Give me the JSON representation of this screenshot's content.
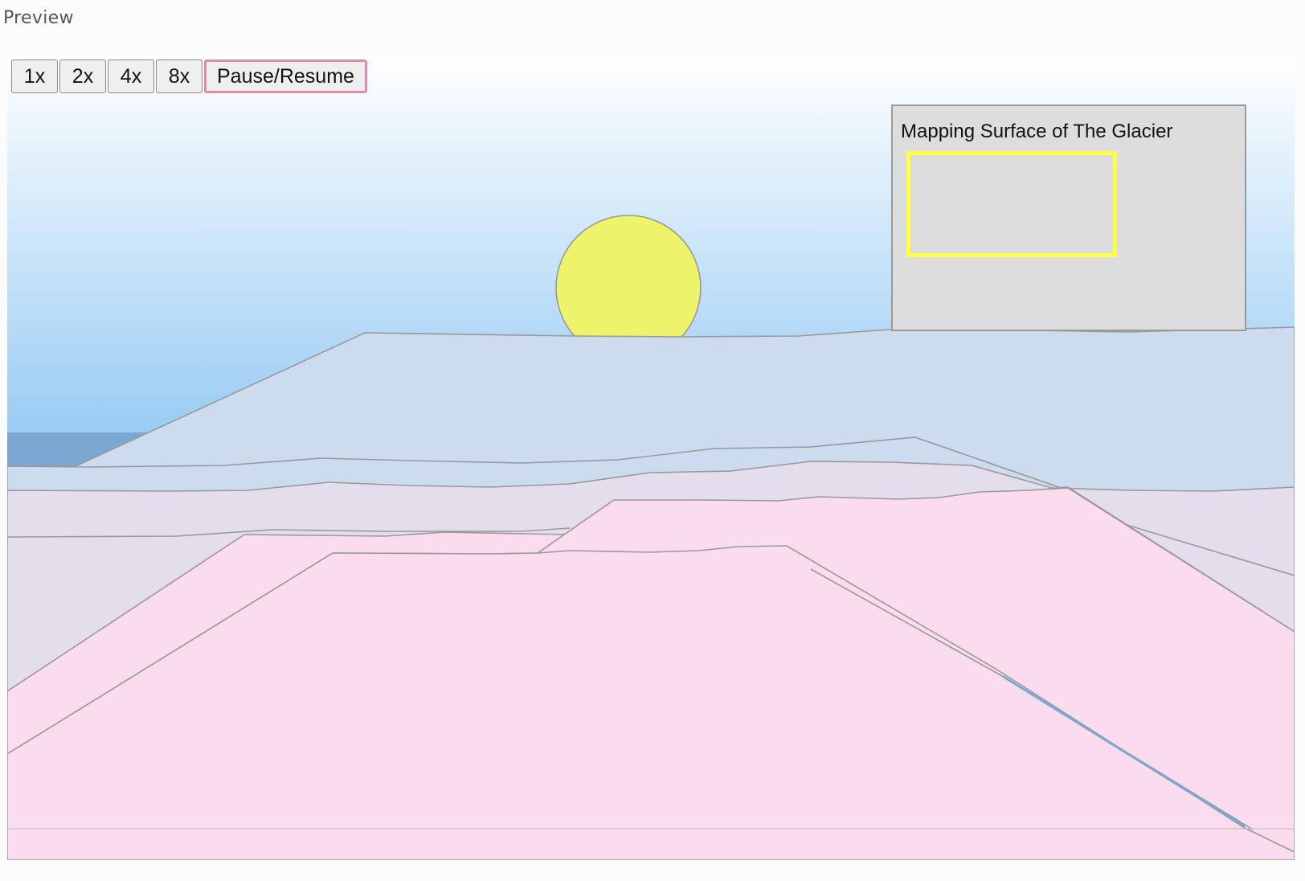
{
  "header": {
    "title": "Preview"
  },
  "controls": {
    "speed_buttons": [
      "1x",
      "2x",
      "4x",
      "8x"
    ],
    "pause_label": "Pause/Resume"
  },
  "map_panel": {
    "title": "Mapping Surface of The Glacier"
  },
  "colors": {
    "sky_top": "#ffffff",
    "sky_bottom": "#92c8f3",
    "sun": "#eef46a",
    "far_ridge": "#ccdbee",
    "mid_terrain": "#e3ddec",
    "near_terrain": "#fadcee",
    "outline": "#999999",
    "viewport_border": "#ffff44",
    "accent_pink": "#e08ab2"
  }
}
